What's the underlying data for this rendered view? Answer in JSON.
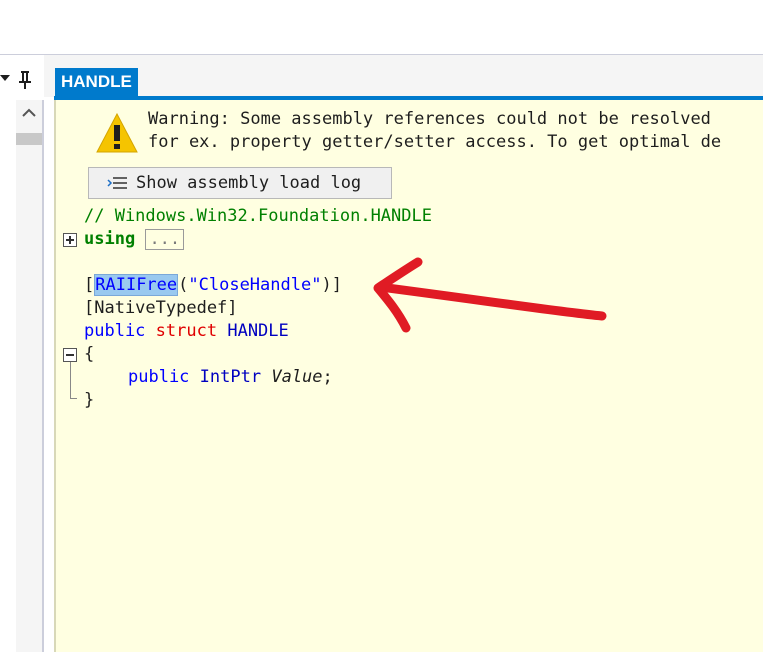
{
  "tab": {
    "label": "HANDLE"
  },
  "warning": {
    "line1": "Warning: Some assembly references could not be resolved",
    "line2": "for ex. property getter/setter access. To get optimal de"
  },
  "log_button": {
    "label": "Show assembly load log"
  },
  "code": {
    "comment": "// Windows.Win32.Foundation.HANDLE",
    "using_kw": "using",
    "using_collapsed": "...",
    "attr_open": "[",
    "attr_name": "RAIIFree",
    "attr_paren_open": "(",
    "attr_arg": "\"CloseHandle\"",
    "attr_close": ")]",
    "attr2": "[NativeTypedef]",
    "kw_public": "public",
    "kw_struct": "struct",
    "struct_name": "HANDLE",
    "brace_open": "{",
    "field_public": "public",
    "field_type": "IntPtr",
    "field_name": "Value",
    "field_semicolon": ";",
    "brace_close": "}"
  },
  "icons": {
    "pin": "pin-icon",
    "dropdown": "dropdown-arrow-icon",
    "scroll_up": "scroll-up-icon",
    "warning": "warning-icon",
    "log": "log-icon",
    "annotation": "red-arrow-annotation"
  },
  "colors": {
    "accent": "#007acc",
    "editor_bg": "#ffffe1",
    "annotation": "#e01b24"
  }
}
